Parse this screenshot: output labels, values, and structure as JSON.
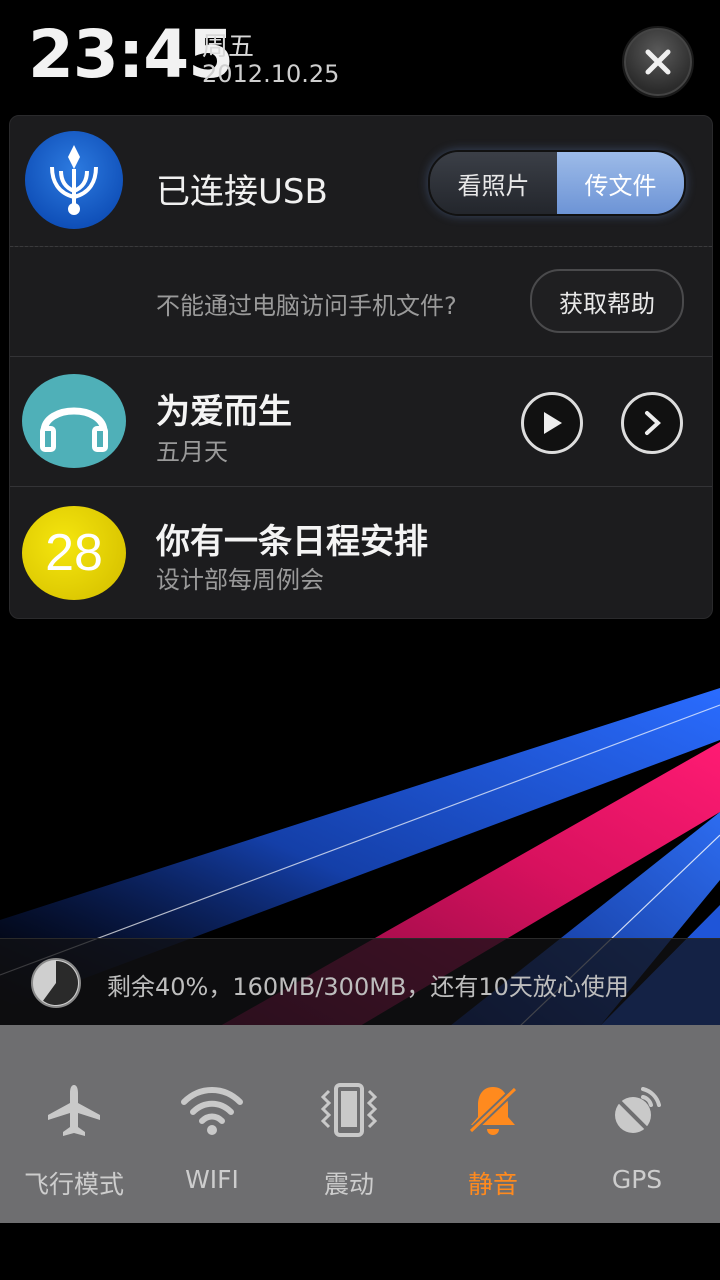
{
  "clock": {
    "time": "23:45",
    "weekday": "周五",
    "date": "2012.10.25"
  },
  "usb": {
    "title": "已连接USB",
    "option_photos": "看照片",
    "option_files": "传文件",
    "help_text": "不能通过电脑访问手机文件?",
    "help_button": "获取帮助"
  },
  "music": {
    "title": "为爱而生",
    "artist": "五月天"
  },
  "calendar": {
    "day": "28",
    "title": "你有一条日程安排",
    "subtitle": "设计部每周例会"
  },
  "data_usage": {
    "text": "剩余40%，160MB/300MB，还有10天放心使用",
    "remaining_fraction": 0.4
  },
  "toggles": [
    {
      "label": "飞行模式",
      "icon": "airplane-icon",
      "active": false
    },
    {
      "label": "WIFI",
      "icon": "wifi-icon",
      "active": false
    },
    {
      "label": "震动",
      "icon": "vibrate-icon",
      "active": false
    },
    {
      "label": "静音",
      "icon": "mute-bell-icon",
      "active": true
    },
    {
      "label": "GPS",
      "icon": "gps-icon",
      "active": false
    }
  ],
  "colors": {
    "active": "#ff8a1e",
    "ribbon_blue": "#1e5fe0",
    "ribbon_pink": "#ff1b6e"
  }
}
